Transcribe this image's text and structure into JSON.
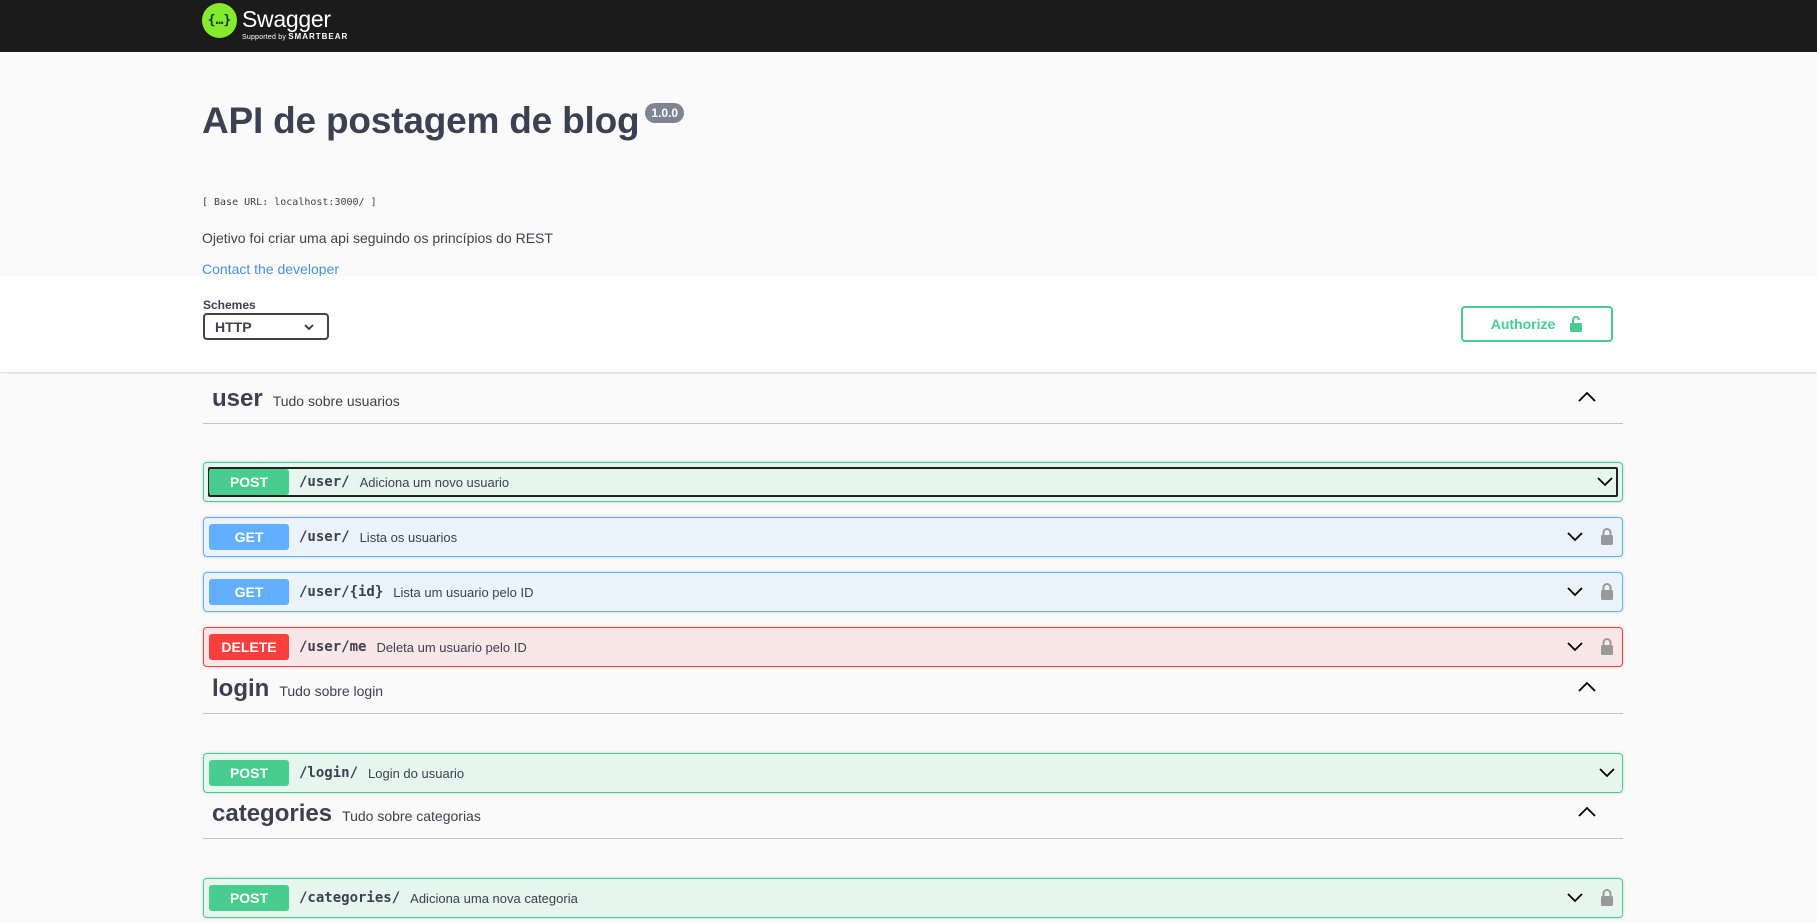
{
  "topbar": {
    "logo_glyph": "{…}",
    "logo_title": "Swagger",
    "logo_supported": "Supported by",
    "logo_brand": "SMARTBEAR"
  },
  "info": {
    "title": "API de postagem de blog",
    "version": "1.0.0",
    "base_url": "[ Base URL: localhost:3000/ ]",
    "description": "Ojetivo foi criar uma api seguindo os princípios do REST",
    "contact": "Contact the developer"
  },
  "schemes": {
    "label": "Schemes",
    "selected": "HTTP"
  },
  "authorize": {
    "label": "Authorize"
  },
  "colors": {
    "post": "#49cc90",
    "get": "#61affe",
    "delete": "#f93e3e",
    "topbar": "#1b1b1b"
  },
  "tags": [
    {
      "name": "user",
      "description": "Tudo sobre usuarios",
      "operations": [
        {
          "method": "POST",
          "path": "/user/",
          "summary": "Adiciona um novo usuario"
        },
        {
          "method": "GET",
          "path": "/user/",
          "summary": "Lista os usuarios"
        },
        {
          "method": "GET",
          "path": "/user/{id}",
          "summary": "Lista um usuario pelo ID"
        },
        {
          "method": "DELETE",
          "path": "/user/me",
          "summary": "Deleta um usuario pelo ID"
        }
      ]
    },
    {
      "name": "login",
      "description": "Tudo sobre login",
      "operations": [
        {
          "method": "POST",
          "path": "/login/",
          "summary": "Login do usuario"
        }
      ]
    },
    {
      "name": "categories",
      "description": "Tudo sobre categorias",
      "operations": [
        {
          "method": "POST",
          "path": "/categories/",
          "summary": "Adiciona uma nova categoria"
        }
      ]
    }
  ]
}
